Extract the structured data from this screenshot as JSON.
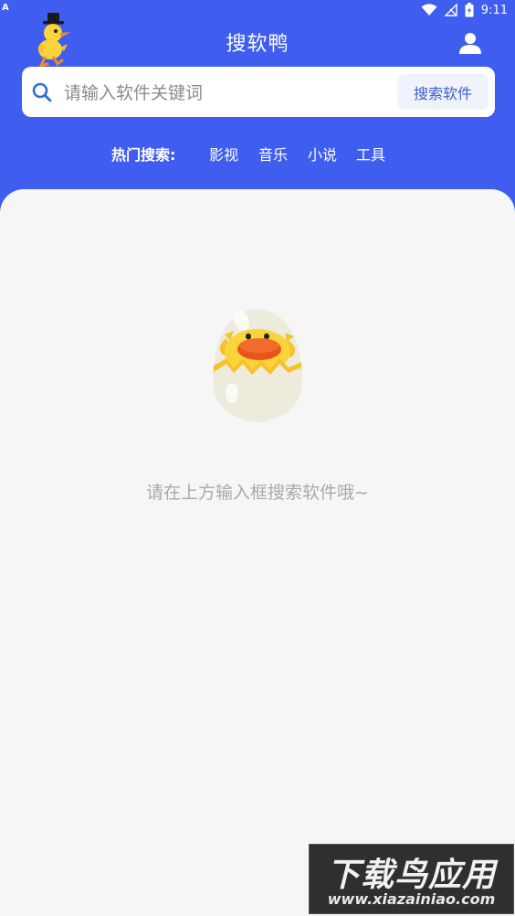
{
  "status_bar": {
    "indicator": "A",
    "time": "9:11",
    "icons": [
      "wifi-icon",
      "signal-icon",
      "battery-icon"
    ]
  },
  "header": {
    "title": "搜软鸭",
    "logo": "duck-logo",
    "user_icon": "user-icon"
  },
  "search": {
    "placeholder": "请输入软件关键词",
    "value": "",
    "button_label": "搜索软件"
  },
  "hot_search": {
    "label": "热门搜索:",
    "items": [
      "影视",
      "音乐",
      "小说",
      "工具"
    ]
  },
  "empty_state": {
    "illustration": "hatching-duck-egg",
    "message": "请在上方输入框搜索软件哦~"
  },
  "watermark": {
    "main": "下载鸟应用",
    "url": "www.xiazainiao.com"
  },
  "colors": {
    "primary": "#3f5ef0",
    "background": "#f6f6f6",
    "button_text": "#3a5fd0",
    "muted_text": "#a9a9a9"
  }
}
